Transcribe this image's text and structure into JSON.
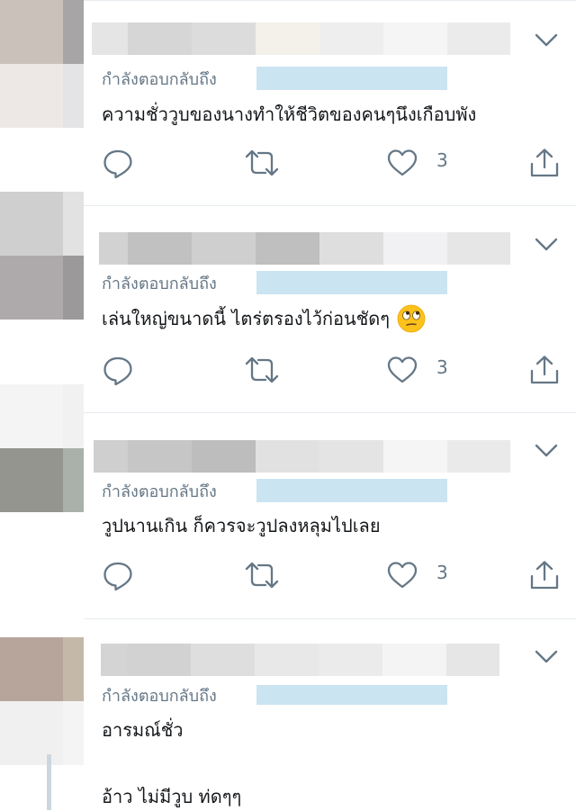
{
  "colors": {
    "text_primary": "#14171a",
    "text_secondary": "#657786",
    "icon": "#657786",
    "mention_highlight": "#cbe4f2",
    "divider": "#e6ecf0"
  },
  "tweets": [
    {
      "replying_label": "กำลังตอบกลับถึง",
      "text": "ความชั่ววูบของนางทำให้ชีวิตของคนๆนึงเกือบพัง",
      "like_count": "3",
      "has_emoji": false
    },
    {
      "replying_label": "กำลังตอบกลับถึง",
      "text": "เล่นใหญ่ขนาดนี้ ไตร่ตรองไว้ก่อนชัดๆ",
      "like_count": "3",
      "has_emoji": true,
      "emoji_icon": "face-with-rolling-eyes-icon"
    },
    {
      "replying_label": "กำลังตอบกลับถึง",
      "text": "วูปนานเกิน ก็ควรจะวูปลงหลุมไปเลย",
      "like_count": "3",
      "has_emoji": false
    },
    {
      "replying_label": "กำลังตอบกลับถึง",
      "text": "อารมณ์ชั่ว",
      "text_2": "อ้าว ไม่มีวูบ ท่ดๆๆ"
    }
  ],
  "icons": {
    "reply": "reply-icon",
    "retweet": "retweet-icon",
    "like": "like-icon",
    "share": "share-icon",
    "more": "chevron-down-icon"
  }
}
